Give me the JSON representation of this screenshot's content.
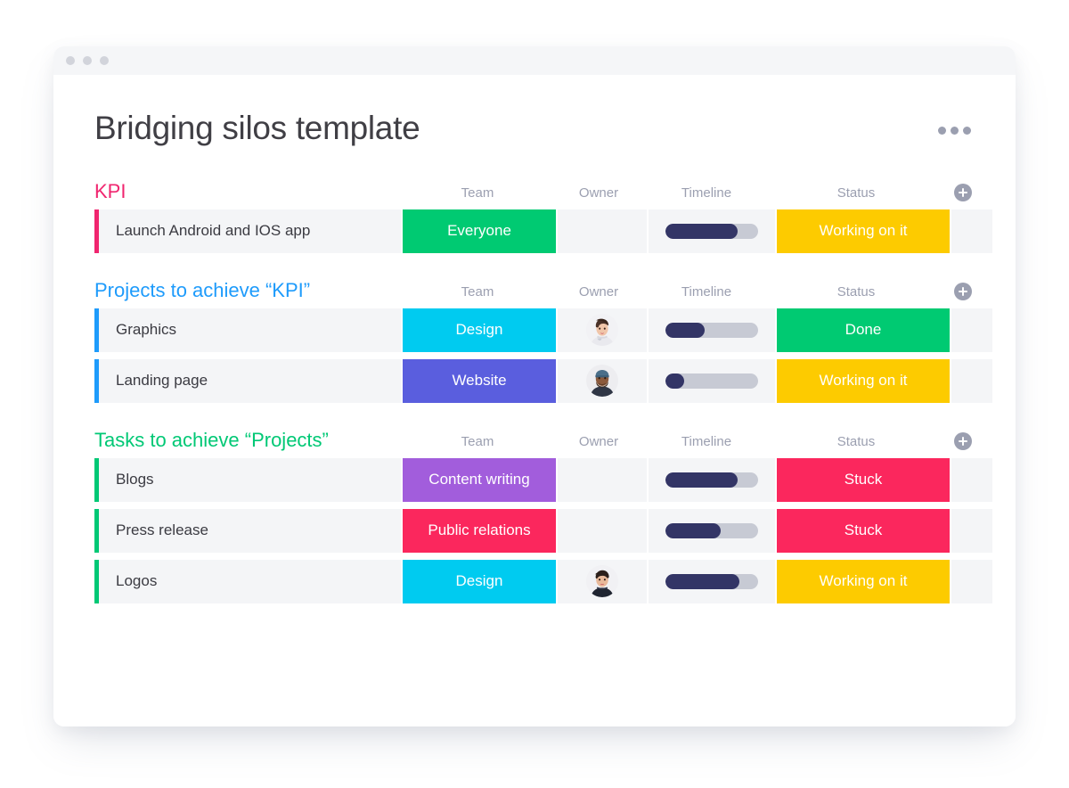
{
  "window": {
    "titlebar_dots": 3
  },
  "header": {
    "title": "Bridging silos template",
    "overflow_menu": "more-options"
  },
  "columns": {
    "name": "",
    "team": "Team",
    "owner": "Owner",
    "timeline": "Timeline",
    "status": "Status",
    "add": "+"
  },
  "palette": {
    "kpi_pink": "#f0256f",
    "projects_blue": "#1e9bfb",
    "tasks_green": "#00c875",
    "green": "#00ca72",
    "yellow": "#fdcb00",
    "red": "#fb275d",
    "cyan": "#00cbf0",
    "violet": "#5a5ede",
    "purple": "#a25ddc",
    "bar_fill": "#333566",
    "bar_track": "#c7cad4",
    "cell_bg": "#f4f5f7"
  },
  "groups": [
    {
      "title": "KPI",
      "title_color": "#f0256f",
      "accent": "#f0256f",
      "rows": [
        {
          "name": "Launch Android and IOS app",
          "team": {
            "label": "Everyone",
            "color": "#00ca72"
          },
          "owner": null,
          "timeline": {
            "percent": 78
          },
          "status": {
            "label": "Working on it",
            "color": "#fdcb00"
          }
        }
      ]
    },
    {
      "title": "Projects to achieve “KPI”",
      "title_color": "#1e9bfb",
      "accent": "#1e9bfb",
      "rows": [
        {
          "name": "Graphics",
          "team": {
            "label": "Design",
            "color": "#00cbf0"
          },
          "owner": {
            "avatar": "woman-avatar"
          },
          "timeline": {
            "percent": 42
          },
          "status": {
            "label": "Done",
            "color": "#00ca72"
          }
        },
        {
          "name": "Landing page",
          "team": {
            "label": "Website",
            "color": "#5a5ede"
          },
          "owner": {
            "avatar": "man-avatar"
          },
          "timeline": {
            "percent": 20
          },
          "status": {
            "label": "Working on it",
            "color": "#fdcb00"
          }
        }
      ]
    },
    {
      "title": "Tasks to achieve “Projects”",
      "title_color": "#00c875",
      "accent": "#00c875",
      "rows": [
        {
          "name": "Blogs",
          "team": {
            "label": "Content writing",
            "color": "#a25ddc"
          },
          "owner": null,
          "timeline": {
            "percent": 78
          },
          "status": {
            "label": "Stuck",
            "color": "#fb275d"
          }
        },
        {
          "name": "Press release",
          "team": {
            "label": "Public relations",
            "color": "#fb275d"
          },
          "owner": null,
          "timeline": {
            "percent": 60
          },
          "status": {
            "label": "Stuck",
            "color": "#fb275d"
          }
        },
        {
          "name": "Logos",
          "team": {
            "label": "Design",
            "color": "#00cbf0"
          },
          "owner": {
            "avatar": "woman-avatar-2"
          },
          "timeline": {
            "percent": 80
          },
          "status": {
            "label": "Working on it",
            "color": "#fdcb00"
          }
        }
      ]
    }
  ]
}
